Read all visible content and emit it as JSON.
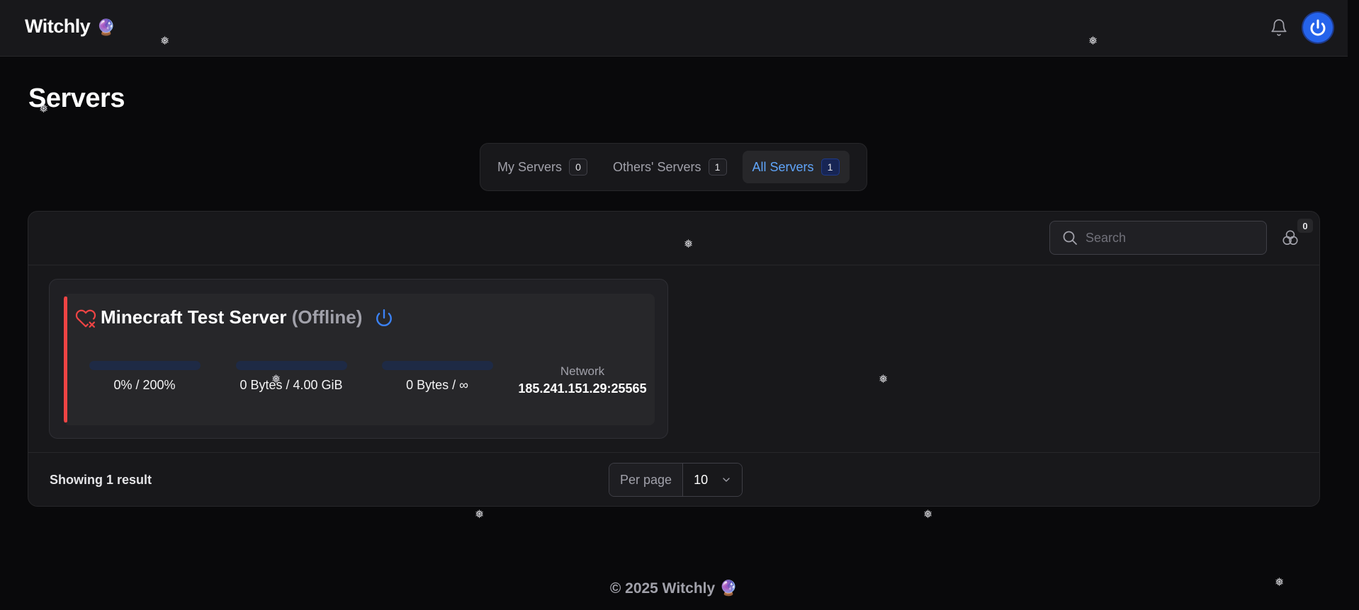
{
  "header": {
    "brand": "Witchly",
    "brand_emoji": "🔮"
  },
  "page": {
    "title": "Servers"
  },
  "tabs": [
    {
      "label": "My Servers",
      "count": "0",
      "active": false
    },
    {
      "label": "Others' Servers",
      "count": "1",
      "active": false
    },
    {
      "label": "All Servers",
      "count": "1",
      "active": true
    }
  ],
  "toolbar": {
    "search_placeholder": "Search",
    "filter_count": "0"
  },
  "server": {
    "name": "Minecraft Test Server",
    "status": "(Offline)",
    "status_color": "#ef4444",
    "cpu": {
      "value": "0% / 200%",
      "fraction": 0
    },
    "memory": {
      "value": "0 Bytes / 4.00 GiB",
      "fraction": 0
    },
    "disk": {
      "value": "0 Bytes / ∞",
      "fraction": 0
    },
    "network_label": "Network",
    "network_address": "185.241.151.29:25565"
  },
  "pagination": {
    "result_text": "Showing 1 result",
    "per_page_label": "Per page",
    "per_page_value": "10"
  },
  "footer": {
    "text": "© 2025 Witchly",
    "emoji": "🔮"
  },
  "colors": {
    "accent": "#3b82f6",
    "background": "#09090b",
    "surface": "#18181b",
    "offline": "#ef4444"
  },
  "icons": {
    "notifications": "bell-icon",
    "account": "power-icon",
    "search": "search-icon",
    "filter": "filter-circles-icon",
    "health": "heart-x-icon",
    "power": "power-icon",
    "dropdown": "chevron-down-icon",
    "decoration": "snowflake-icon"
  }
}
